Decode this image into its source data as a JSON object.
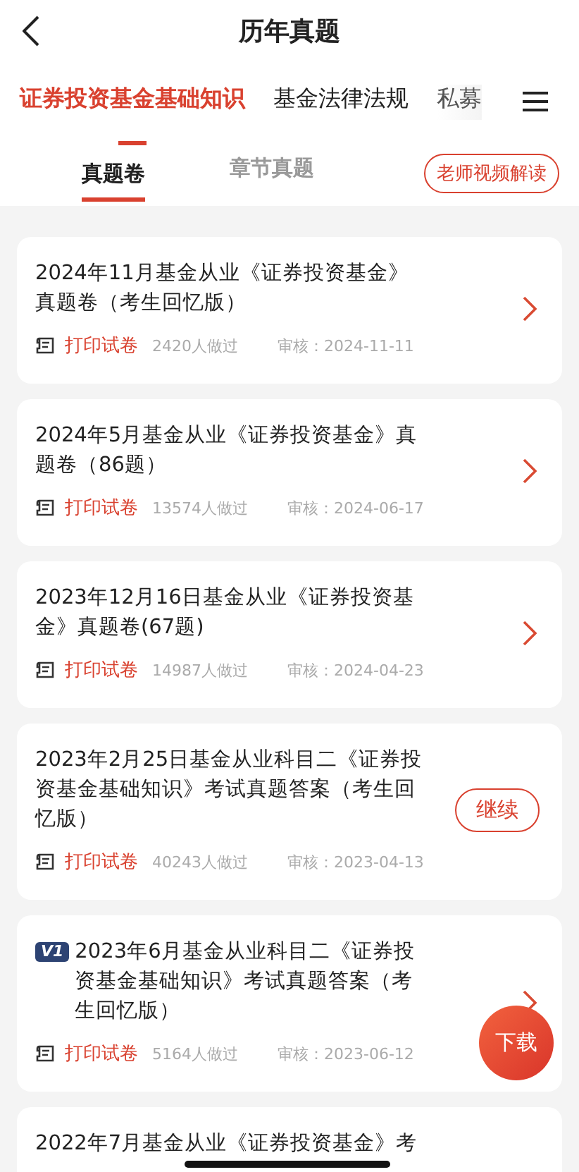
{
  "header": {
    "title": "历年真题"
  },
  "subjects": [
    {
      "label": "证券投资基金基础知识",
      "selected": true
    },
    {
      "label": "基金法律法规",
      "selected": false
    },
    {
      "label": "私募",
      "selected": false
    }
  ],
  "sub_tabs": [
    {
      "label": "真题卷",
      "selected": true
    },
    {
      "label": "章节真题",
      "selected": false
    }
  ],
  "video_button": "老师视频解读",
  "papers": [
    {
      "title": "2024年11月基金从业《证券投资基金》真题卷（考生回忆版）",
      "print": "打印试卷",
      "count": "2420人做过",
      "review": "审核：2024-11-11",
      "kind": "chevron"
    },
    {
      "title": "2024年5月基金从业《证券投资基金》真题卷（86题）",
      "print": "打印试卷",
      "count": "13574人做过",
      "review": "审核：2024-06-17",
      "kind": "chevron"
    },
    {
      "title": "2023年12月16日基金从业《证券投资基金》真题卷(67题)",
      "print": "打印试卷",
      "count": "14987人做过",
      "review": "审核：2024-04-23",
      "kind": "chevron"
    },
    {
      "title": "2023年2月25日基金从业科目二《证券投资基金基础知识》考试真题答案（考生回忆版）",
      "print": "打印试卷",
      "count": "40243人做过",
      "review": "审核：2023-04-13",
      "kind": "continue",
      "action": "继续"
    },
    {
      "badge": "V1",
      "title": "2023年6月基金从业科目二《证券投资基金基础知识》考试真题答案（考生回忆版）",
      "print": "打印试卷",
      "count": "5164人做过",
      "review": "审核：2023-06-12",
      "kind": "chevron"
    },
    {
      "title": "2022年7月基金从业《证券投资基金》考",
      "kind": "partial"
    }
  ],
  "download_button": "下载"
}
